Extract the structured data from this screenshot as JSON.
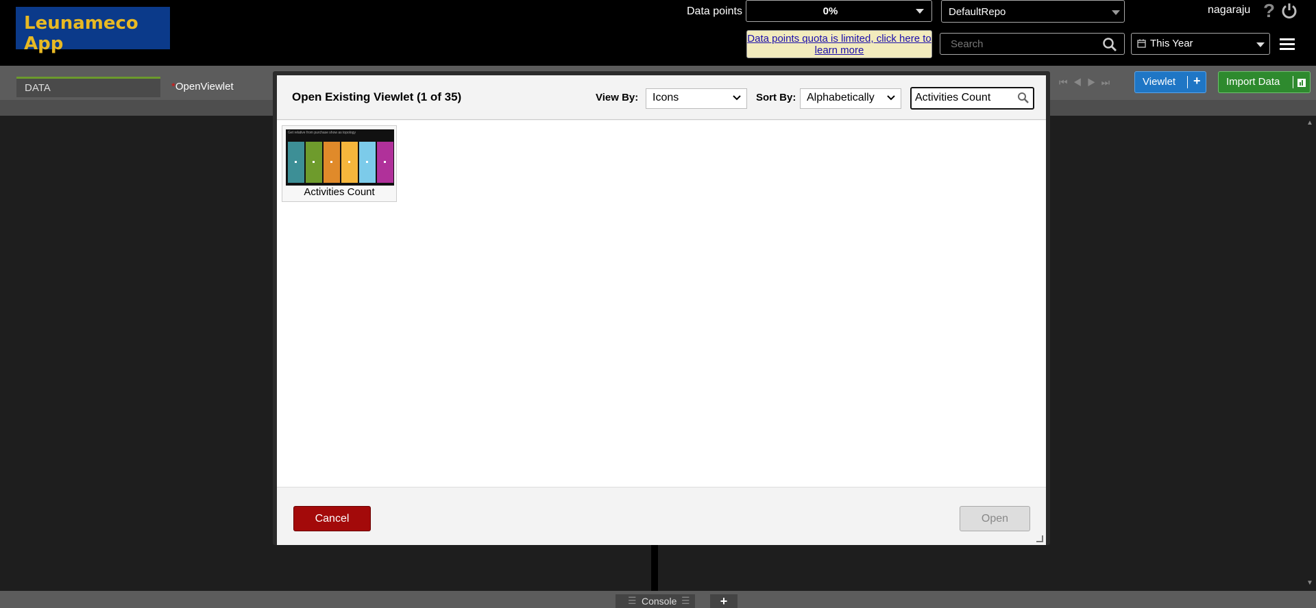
{
  "header": {
    "logo_text": "Leunameco App",
    "data_points_label": "Data points",
    "data_points_value": "0%",
    "repo_value": "DefaultRepo",
    "quota_message": "Data points quota is limited, click here to learn more",
    "search_placeholder": "Search",
    "time_range": "This Year",
    "username": "nagaraju",
    "help_glyph": "?"
  },
  "tabs": {
    "data_tab": "DATA",
    "open_tab_star": "*",
    "open_tab": "OpenViewlet",
    "viewlet_button": "Viewlet",
    "import_button": "Import Data"
  },
  "bottom": {
    "console_label": "Console",
    "add_glyph": "+"
  },
  "modal": {
    "title": "Open Existing Viewlet (1 of 35)",
    "view_by_label": "View By:",
    "view_by_value": "Icons",
    "sort_by_label": "Sort By:",
    "sort_by_value": "Alphabetically",
    "filter_value": "Activities Count",
    "items": [
      {
        "label": "Activities Count",
        "thumb_title": "Get relative from purchase show as topology",
        "bar_colors": [
          "#3d8f96",
          "#6e9b2c",
          "#e08a2a",
          "#f5b63c",
          "#7ccbea",
          "#b0319a"
        ]
      }
    ],
    "cancel_label": "Cancel",
    "open_label": "Open"
  }
}
